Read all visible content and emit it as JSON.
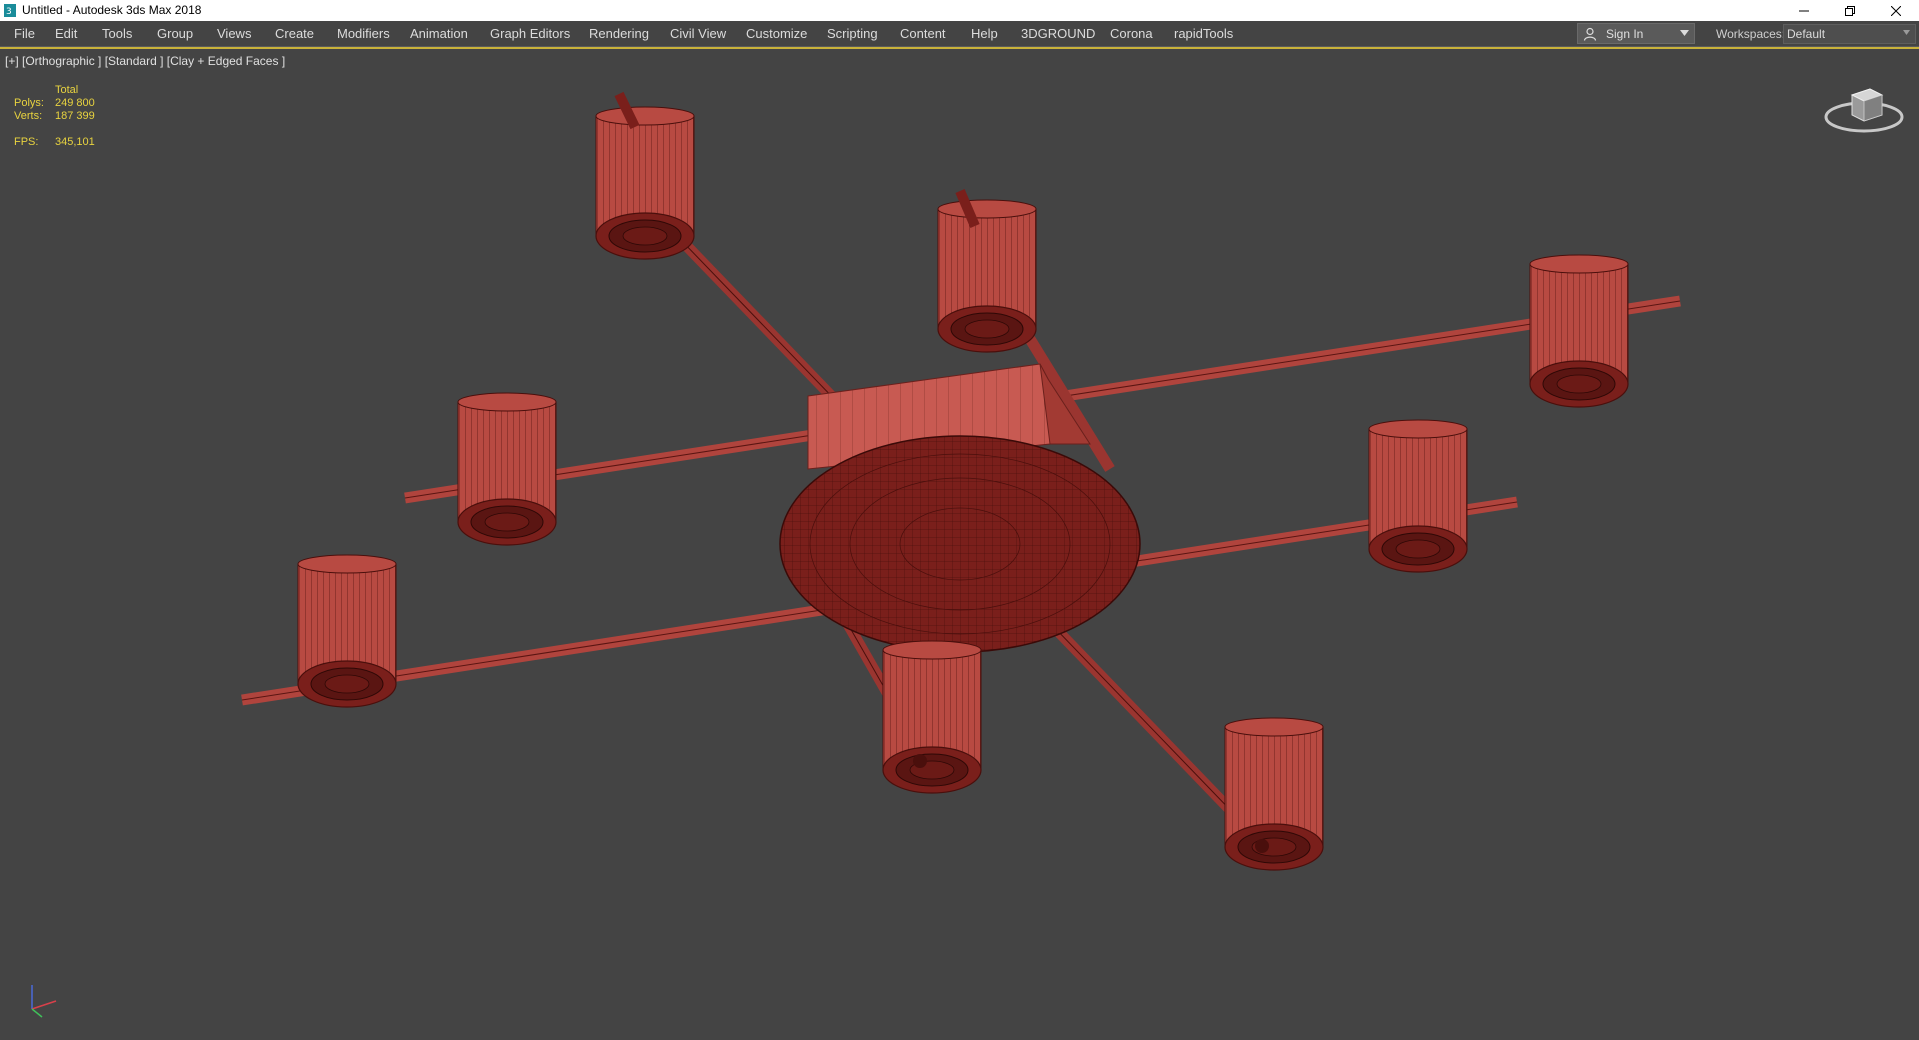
{
  "window": {
    "title": "Untitled - Autodesk 3ds Max 2018",
    "controls": [
      "minimize-icon",
      "restore-icon",
      "close-icon"
    ]
  },
  "menubar": {
    "items": [
      "File",
      "Edit",
      "Tools",
      "Group",
      "Views",
      "Create",
      "Modifiers",
      "Animation",
      "Graph Editors",
      "Rendering",
      "Civil View",
      "Customize",
      "Scripting",
      "Content",
      "Help",
      "3DGROUND",
      "Corona",
      "rapidTools"
    ]
  },
  "account": {
    "sign_in": "Sign In"
  },
  "workspaces": {
    "label": "Workspaces:",
    "value": "Default"
  },
  "viewport": {
    "label": "[+] [Orthographic ] [Standard ] [Clay + Edged Faces ]",
    "stats": {
      "header": "Total",
      "polys_label": "Polys:",
      "polys": "249 800",
      "verts_label": "Verts:",
      "verts": "187 399",
      "fps_label": "FPS:",
      "fps": "345,101"
    }
  },
  "colors": {
    "background": "#444444",
    "model_fill": "#b84a42",
    "model_wire": "#5a1512",
    "stats_text": "#e8d33f",
    "active_border": "#c9b23a"
  },
  "icons": {
    "app": "3ds-max-icon",
    "navigation": "viewcube-icon",
    "axes": "axis-tripod-icon"
  }
}
